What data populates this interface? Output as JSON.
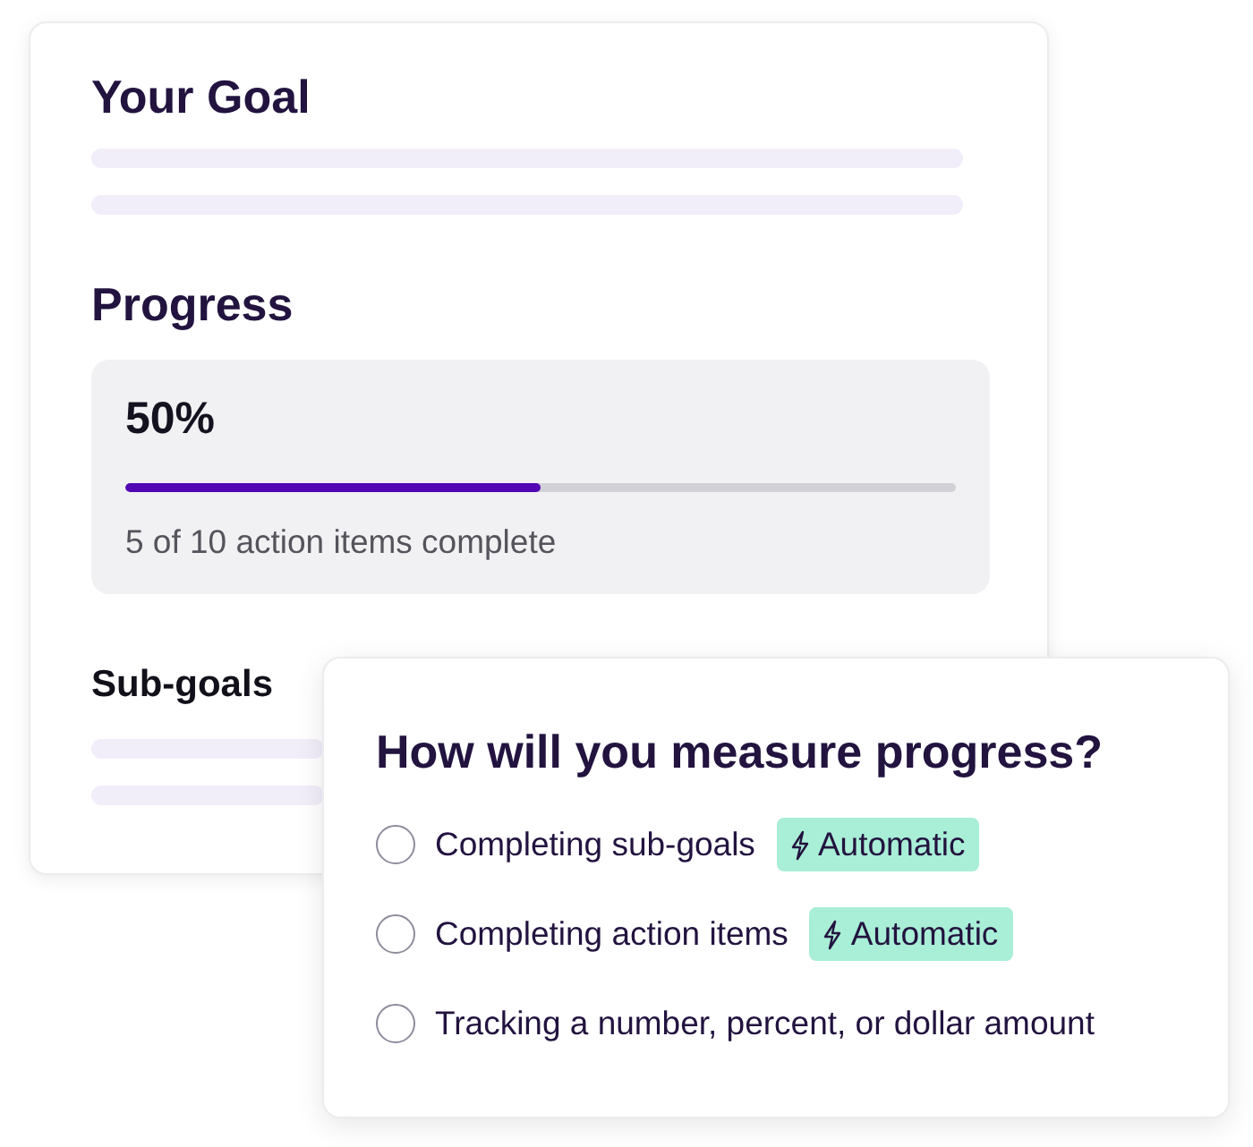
{
  "goal_card": {
    "title": "Your Goal",
    "progress_heading": "Progress",
    "progress": {
      "percent": "50%",
      "level": 0.5,
      "caption": "5 of 10 action items complete"
    },
    "subgoals_heading": "Sub-goals"
  },
  "measure_popup": {
    "title": "How will you measure progress?",
    "options": [
      {
        "label": "Completing sub-goals",
        "selected": false,
        "badge": "Automatic"
      },
      {
        "label": "Completing action items",
        "selected": false,
        "badge": "Automatic"
      },
      {
        "label": "Tracking a number, percent, or dollar amount",
        "selected": false
      }
    ]
  }
}
